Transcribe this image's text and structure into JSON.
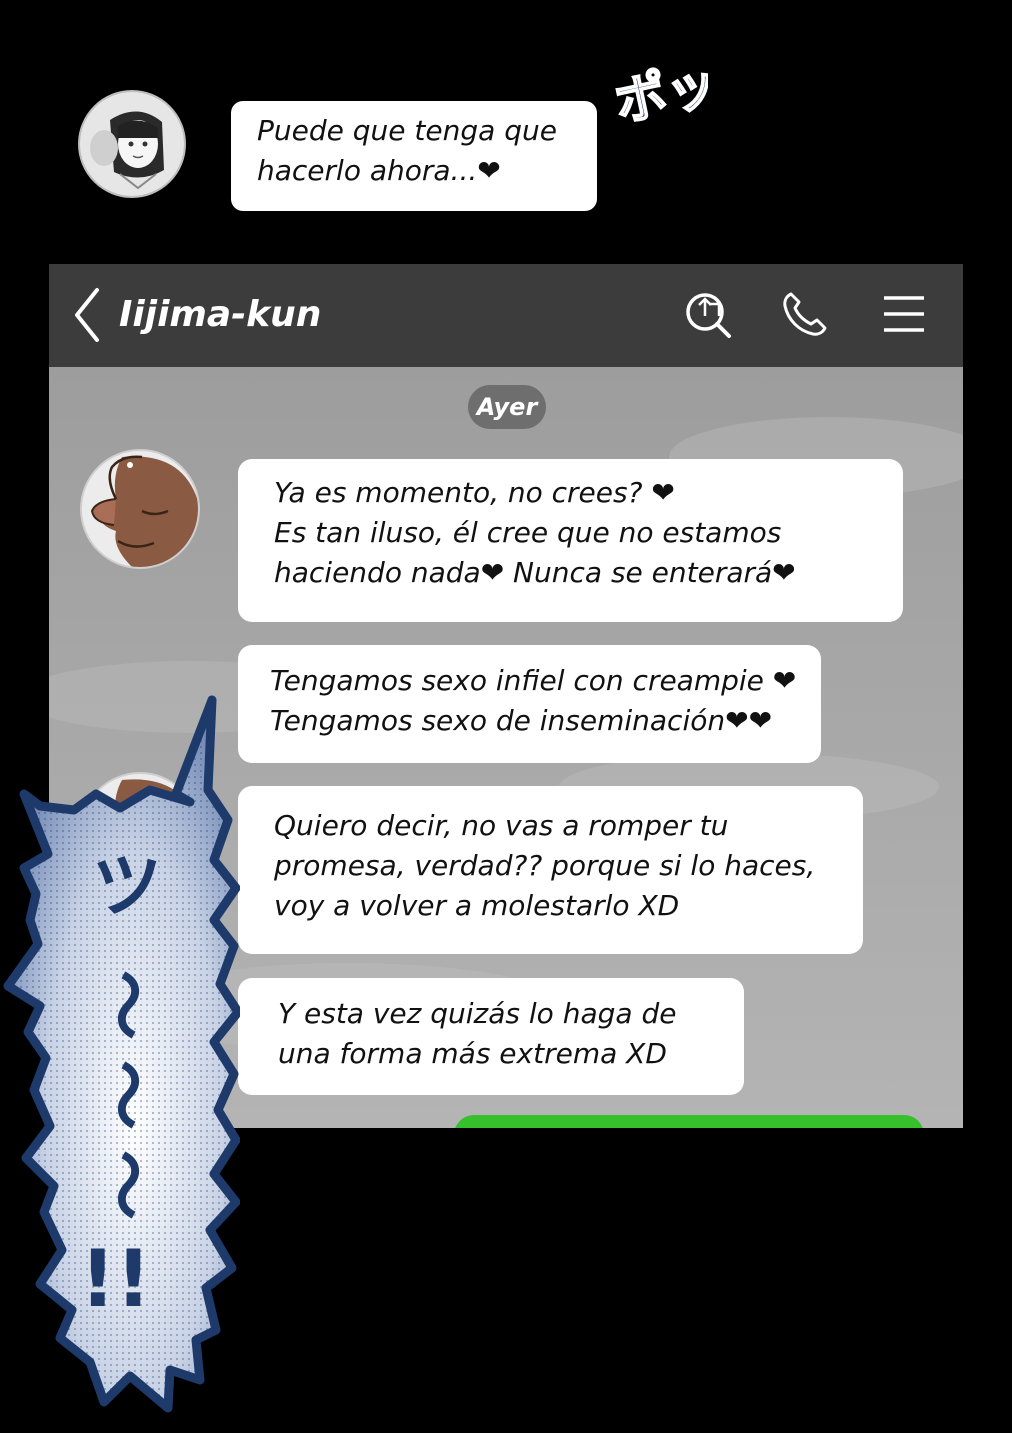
{
  "top_message": {
    "text": "Puede que tenga que\nhacerlo ahora...❤"
  },
  "sfx": {
    "corner": "ポッ",
    "balloon_chars": [
      "ツ",
      "〜",
      "〜",
      "〜",
      "!!"
    ]
  },
  "chat": {
    "contact_name": "Iijima-kun",
    "date_label": "Ayer",
    "messages": [
      "Ya es momento, no crees? ❤\nEs tan iluso, él cree que no estamos\nhaciendo nada❤  Nunca se enterará❤",
      "Tengamos sexo infiel con creampie ❤\nTengamos sexo de inseminación❤❤",
      "Quiero decir, no vas a romper tu\npromesa, verdad?? porque si lo haces,\nvoy a volver a molestarlo XD",
      "Y esta vez quizás lo haga de\nuna forma más extrema XD"
    ]
  },
  "icons": {
    "header": [
      "back-icon",
      "search-icon",
      "call-icon",
      "menu-icon"
    ]
  },
  "colors": {
    "header_bg": "#3c3c3c",
    "chat_bg": "#a9a9a9",
    "sent_bubble": "#36c02b",
    "balloon_outline": "#1d3a6b"
  }
}
